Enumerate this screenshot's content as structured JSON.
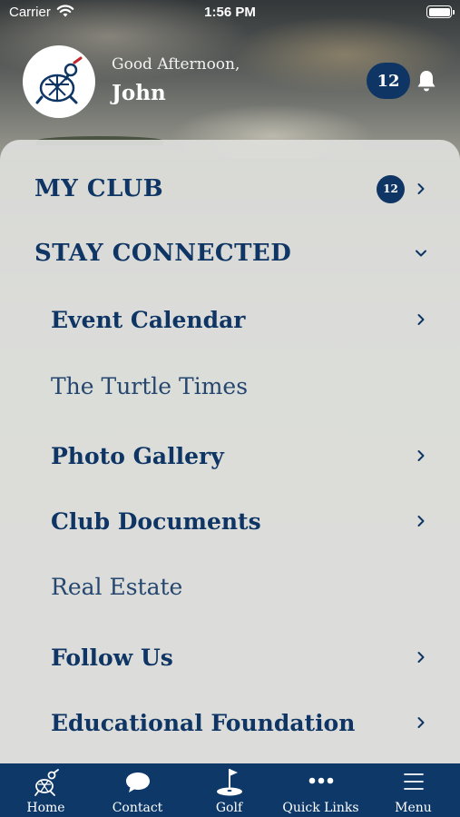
{
  "status_bar": {
    "carrier": "Carrier",
    "time": "1:56 PM"
  },
  "header": {
    "greeting": "Good Afternoon,",
    "user_name": "John",
    "notification_count": "12"
  },
  "menu": {
    "my_club": {
      "label": "MY CLUB",
      "badge": "12"
    },
    "stay_connected": {
      "label": "STAY CONNECTED"
    },
    "items": [
      {
        "label": "Event Calendar"
      },
      {
        "label": "The Turtle Times"
      },
      {
        "label": "Photo Gallery"
      },
      {
        "label": "Club Documents"
      },
      {
        "label": "Real Estate"
      },
      {
        "label": "Follow Us"
      },
      {
        "label": "Educational Foundation"
      }
    ]
  },
  "tabbar": {
    "tabs": [
      {
        "label": "Home",
        "icon": "turtle-icon"
      },
      {
        "label": "Contact",
        "icon": "chat-bubble-icon"
      },
      {
        "label": "Golf",
        "icon": "golf-flag-icon"
      },
      {
        "label": "Quick Links",
        "icon": "more-dots-icon"
      },
      {
        "label": "Menu",
        "icon": "hamburger-icon"
      }
    ]
  },
  "colors": {
    "brand_navy": "#0f3564",
    "tabbar_bg": "#0e3868",
    "panel_bg": "#dedfdc"
  }
}
